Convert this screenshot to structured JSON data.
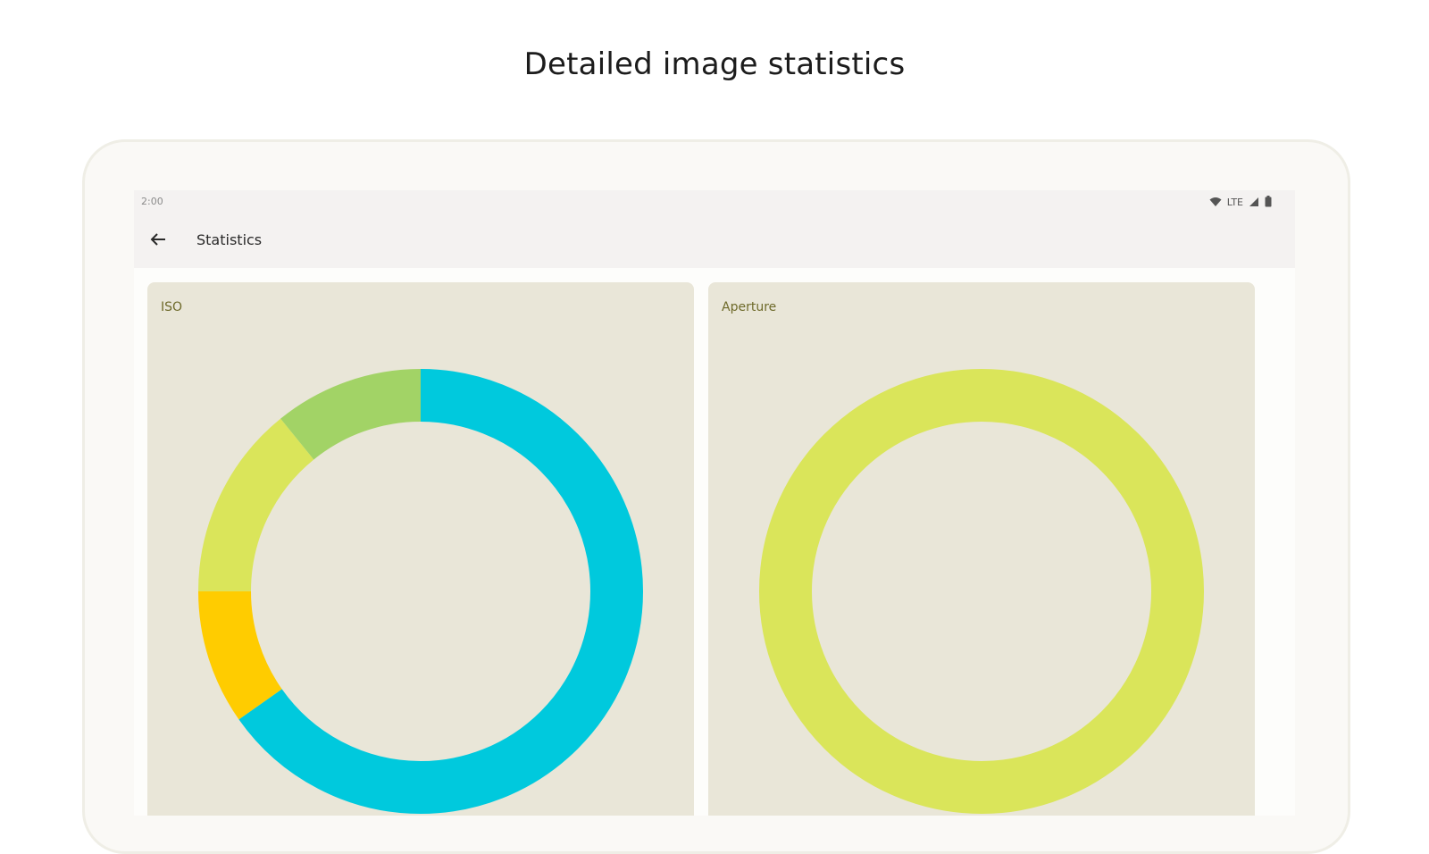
{
  "headline": "Detailed image statistics",
  "status_bar": {
    "time": "2:00",
    "network": "LTE"
  },
  "app_bar": {
    "title": "Statistics"
  },
  "chart_data": [
    {
      "type": "pie",
      "title": "ISO",
      "donut": true,
      "series": [
        {
          "name": "",
          "value": 0.6,
          "color": "#00c9dd"
        },
        {
          "name": "",
          "value": 0.09,
          "color": "#ffcc00"
        },
        {
          "name": "",
          "value": 0.13,
          "color": "#dae55a"
        },
        {
          "name": "",
          "value": 0.1,
          "color": "#a2d366"
        }
      ]
    },
    {
      "type": "pie",
      "title": "Aperture",
      "donut": true,
      "series": [
        {
          "name": "",
          "value": 1.0,
          "color": "#dae55a"
        }
      ]
    }
  ]
}
